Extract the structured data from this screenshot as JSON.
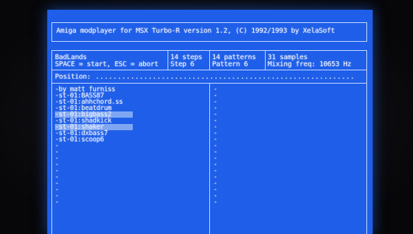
{
  "title_bar": {
    "text": "Amiga modplayer for MSX Turbo-R version 1.2, (C) 1992/1993 by XelaSoft"
  },
  "info": {
    "song_name": "BadLands",
    "controls": "SPACE = start, ESC = abort",
    "steps": "14 steps",
    "step": "Step 6",
    "patterns": "14 patterns",
    "pattern": "Pattern 6",
    "samples": "31 samples",
    "mixing": "Mixing freq: 10653 Hz"
  },
  "position": {
    "label": "Position:",
    "dots": "..........................................................."
  },
  "samples_list": [
    {
      "name": "-by matt furniss",
      "selected": false
    },
    {
      "name": "-st-01:BASS87",
      "selected": false
    },
    {
      "name": "-st-01:ahhchord.ss",
      "selected": false
    },
    {
      "name": "-st-01:beatdrum",
      "selected": false
    },
    {
      "name": "-st-01:bigbass2",
      "selected": true
    },
    {
      "name": "-st-01:shadkick",
      "selected": false
    },
    {
      "name": "-st-01:shaker",
      "selected": true
    },
    {
      "name": "-st-01:dxbass7",
      "selected": false
    },
    {
      "name": "-st-01:scoop6",
      "selected": false
    },
    {
      "name": "-",
      "selected": false
    },
    {
      "name": "-",
      "selected": false
    },
    {
      "name": "-",
      "selected": false
    },
    {
      "name": "-",
      "selected": false
    },
    {
      "name": "-",
      "selected": false
    },
    {
      "name": "-",
      "selected": false
    },
    {
      "name": "-",
      "selected": false
    },
    {
      "name": "-",
      "selected": false
    },
    {
      "name": "-",
      "selected": false
    },
    {
      "name": "-",
      "selected": false
    }
  ],
  "right_column_rows": [
    "-",
    "-",
    "-",
    "-",
    "-",
    "-",
    "-",
    "-",
    "-",
    "-",
    "-",
    "-",
    "-",
    "-",
    "-",
    "-",
    "-",
    "-",
    "-"
  ],
  "colors": {
    "screen_blue": "#1e5ee8",
    "text": "#f2f6ff",
    "highlight": "#7fa6f2"
  }
}
